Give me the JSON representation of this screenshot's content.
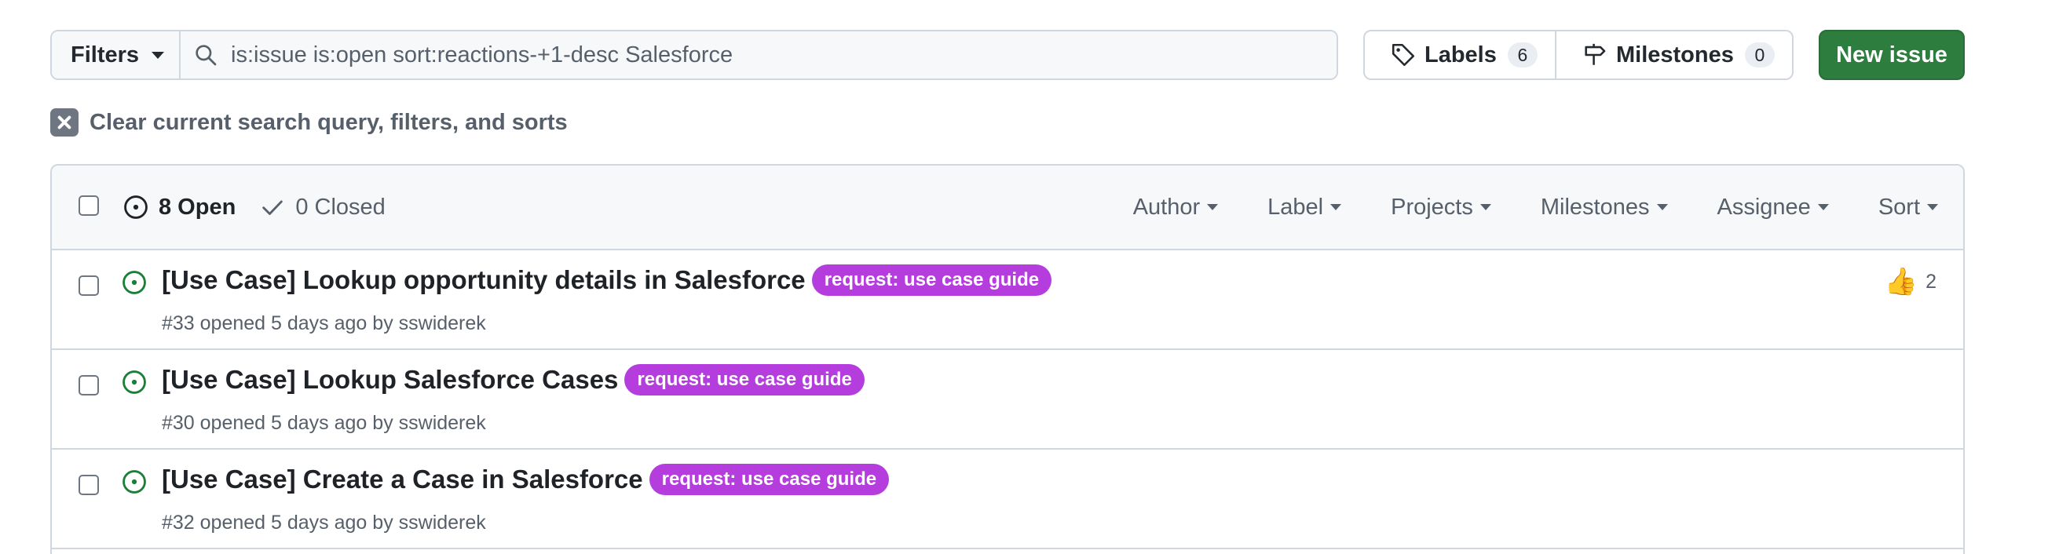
{
  "toolbar": {
    "filters_label": "Filters",
    "search_value": "is:issue is:open sort:reactions-+1-desc Salesforce",
    "labels_label": "Labels",
    "labels_count": "6",
    "milestones_label": "Milestones",
    "milestones_count": "0",
    "new_issue_label": "New issue"
  },
  "clear": {
    "text": "Clear current search query, filters, and sorts"
  },
  "issues_header": {
    "open_label": "8 Open",
    "closed_label": "0 Closed",
    "filters": [
      "Author",
      "Label",
      "Projects",
      "Milestones",
      "Assignee",
      "Sort"
    ]
  },
  "issues": [
    {
      "title": "[Use Case] Lookup opportunity details in Salesforce",
      "label": "request: use case guide",
      "meta": "#33 opened 5 days ago by sswiderek",
      "reaction_count": "2",
      "reaction_icon": "thumbs-up-icon"
    },
    {
      "title": "[Use Case] Lookup Salesforce Cases",
      "label": "request: use case guide",
      "meta": "#30 opened 5 days ago by sswiderek"
    },
    {
      "title": "[Use Case] Create a Case in Salesforce",
      "label": "request: use case guide",
      "meta": "#32 opened 5 days ago by sswiderek"
    }
  ],
  "colors": {
    "accent_green": "#2c7d3e",
    "open_icon_green": "#1a7f37",
    "label_purple": "#b53ddd",
    "border": "#d0d7de"
  }
}
